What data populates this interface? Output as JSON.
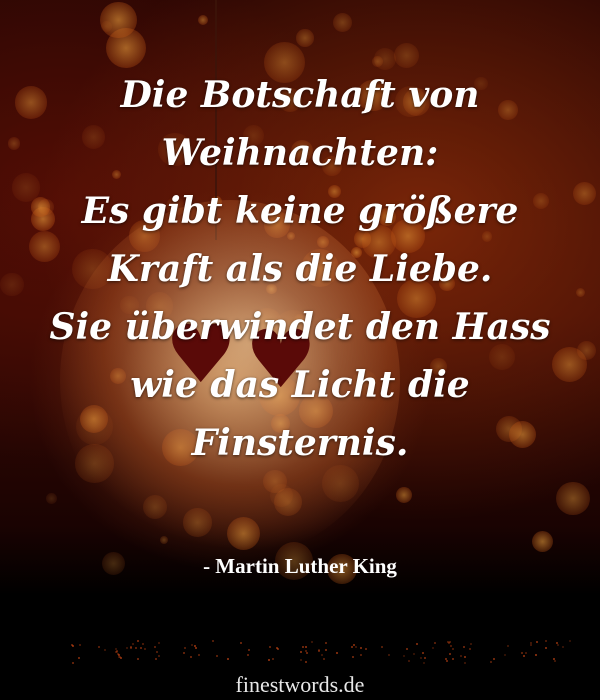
{
  "quote": {
    "lines": [
      "Die Botschaft von",
      "Weihnachten:",
      "Es gibt keine größere",
      "Kraft als die Liebe.",
      "Sie überwindet den Hass",
      "wie das Licht die",
      "Finsternis."
    ],
    "author": "- Martin Luther King"
  },
  "footer": {
    "website": "finestwords.de"
  },
  "colors": {
    "background": "#2a0603",
    "bokeh": "#e08a2a",
    "text": "#ffffff"
  }
}
